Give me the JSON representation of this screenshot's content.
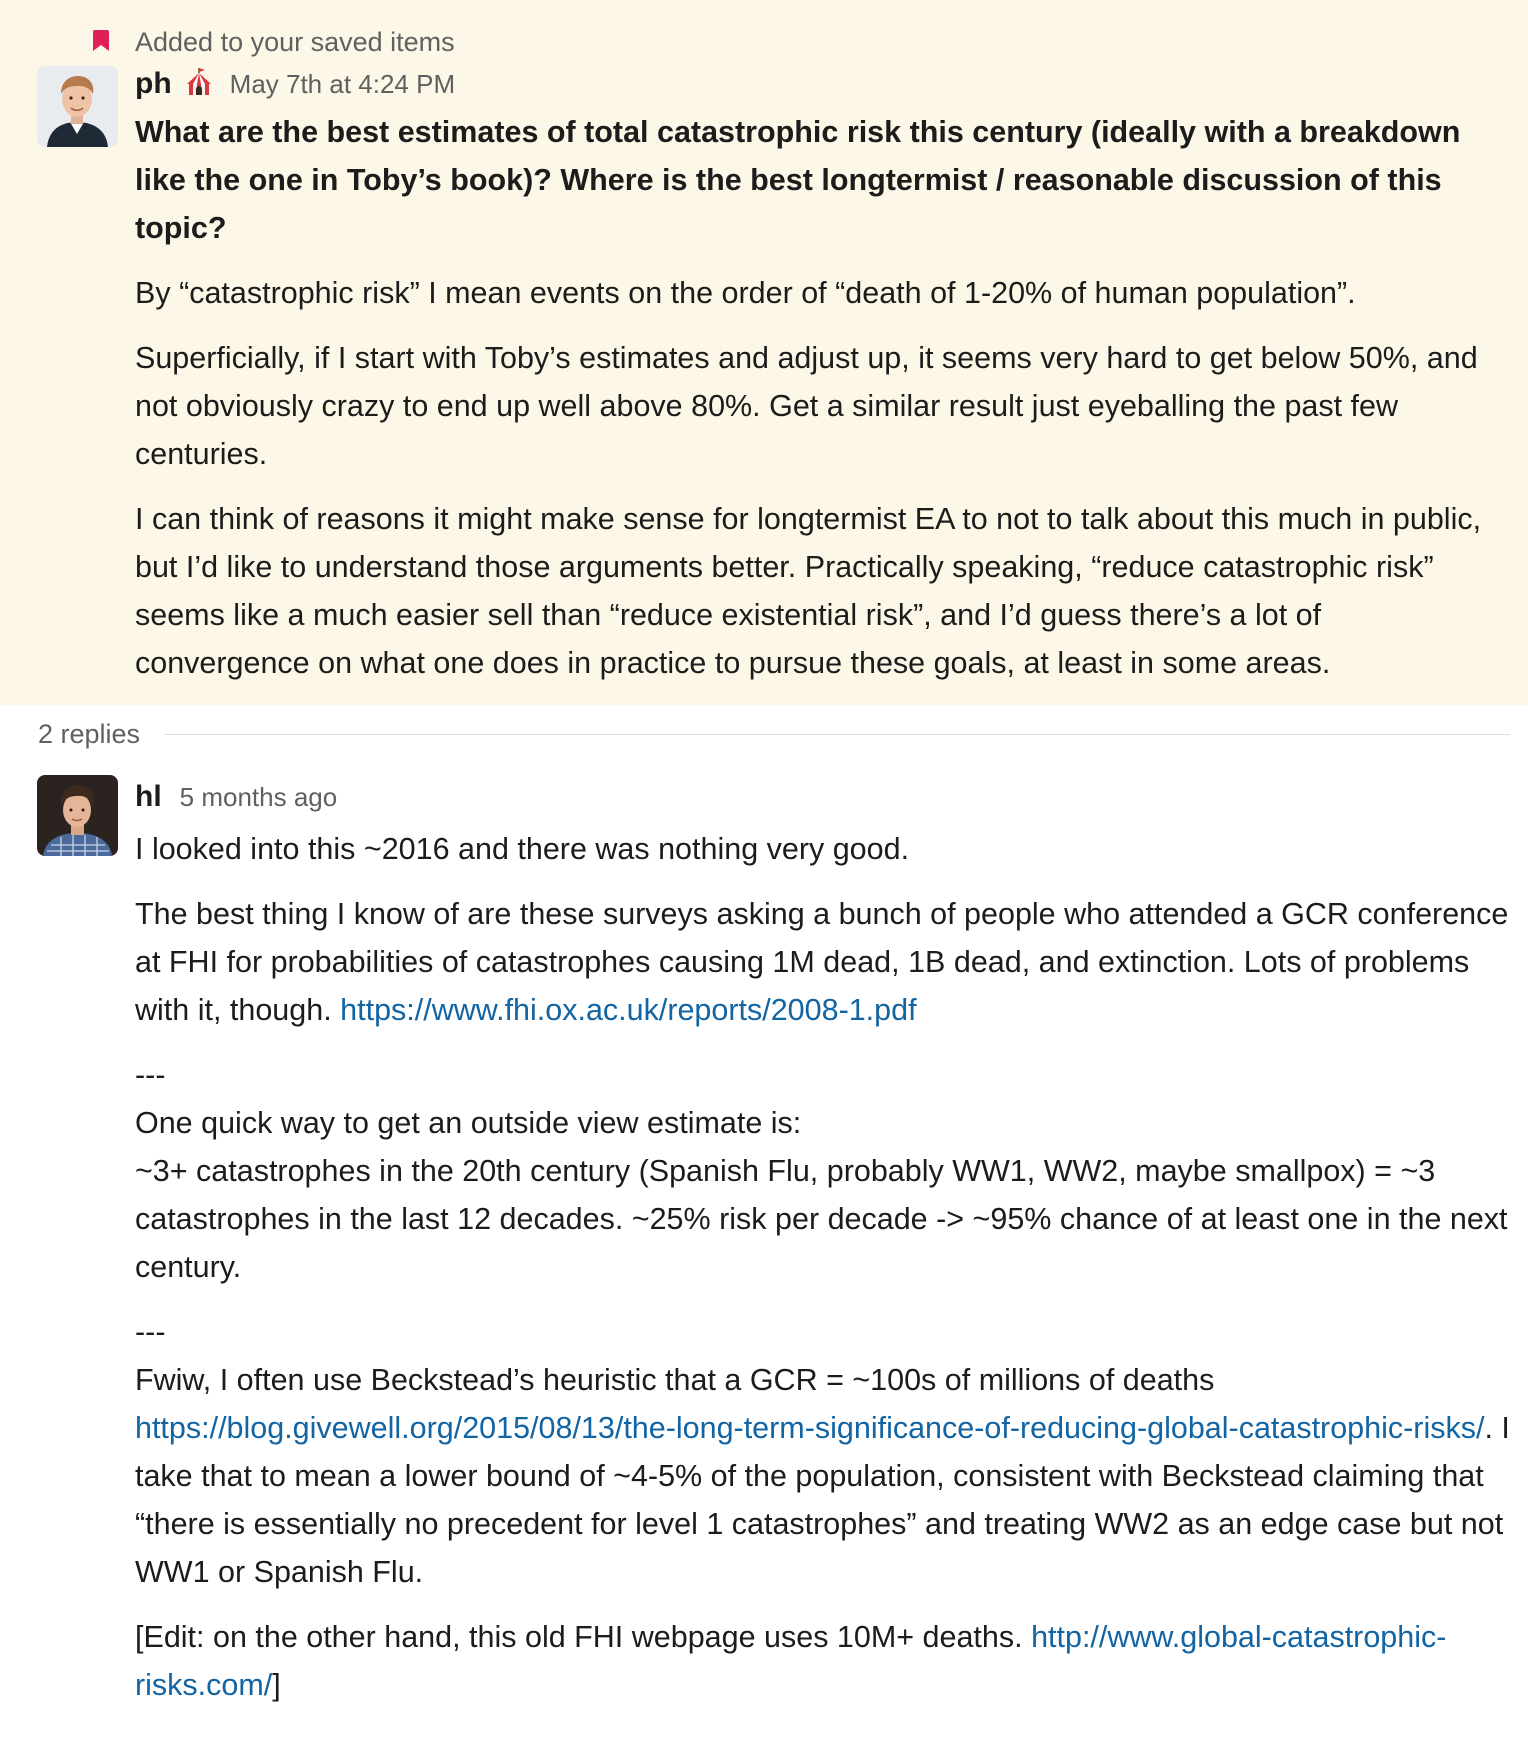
{
  "saved_banner": {
    "icon": "bookmark-icon",
    "text": "Added to your saved items",
    "color": "#e01e5a"
  },
  "parent_message": {
    "author": "ph",
    "status_emoji": "circus-tent",
    "timestamp": "May 7th at 4:24 PM",
    "question": "What are the best estimates of total catastrophic risk this century (ideally with a breakdown like the one in Toby’s book)? Where is the best longtermist / reasonable discussion of this topic?",
    "paragraphs": [
      "By “catastrophic risk” I mean events on the order of “death of 1-20% of human population”.",
      "Superficially, if I start with Toby’s estimates and adjust up, it seems very hard to get below 50%, and not obviously crazy to end up well above 80%. Get a similar result just eyeballing the past few centuries.",
      "I can think of reasons it might make sense for longtermist EA to not to talk about this much in public, but I’d like to understand those arguments better. Practically speaking, “reduce catastrophic risk” seems like a much easier sell than “reduce existential risk”, and I’d guess there’s a lot of convergence on what one does in practice to pursue these goals, at least in some areas."
    ]
  },
  "replies_label": "2 replies",
  "reply": {
    "author": "hl",
    "timestamp": "5 months ago",
    "p1": "I looked into this ~2016 and there was nothing very good.",
    "p2_text": "The best thing I know of are these surveys asking a bunch of people who attended a GCR conference at FHI for probabilities of catastrophes causing 1M dead, 1B dead, and extinction. Lots of problems with it, though. ",
    "p2_link": "https://www.fhi.ox.ac.uk/reports/2008-1.pdf",
    "separator1": "---",
    "p3_line1": "One quick way to get an outside view estimate is:",
    "p3_line2": " ~3+ catastrophes in the 20th century (Spanish Flu, probably WW1, WW2, maybe smallpox) = ~3 catastrophes in the last 12 decades. ~25% risk per decade -> ~95% chance of at least one in the next century.",
    "separator2": "---",
    "p4_text": "Fwiw, I often use Beckstead’s heuristic that a GCR = ~100s of millions of deaths ",
    "p4_link": "https://blog.givewell.org/2015/08/13/the-long-term-significance-of-reducing-global-catastrophic-risks/",
    "p4_rest": ". I take that to mean a lower bound of ~4-5% of the population, consistent with Beckstead claiming that “there is essentially no precedent for level 1 catastrophes” and treating WW2 as an edge case but not WW1 or Spanish Flu.",
    "p5_text": "[Edit: on the other hand, this old FHI webpage uses 10M+ deaths. ",
    "p5_link": "http://www.global-catastrophic-risks.com/",
    "p5_end": "]"
  },
  "colors": {
    "saved_background": "#fcf7e6",
    "link": "#1264a3",
    "muted_text": "#616061",
    "text": "#1d1c1d"
  }
}
